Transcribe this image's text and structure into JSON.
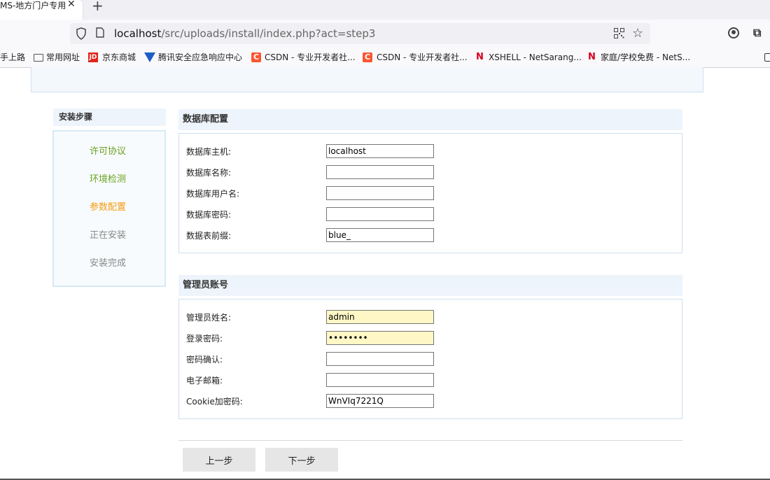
{
  "browser": {
    "tab_title": "MS-地方门户专用",
    "tab_close": "✕",
    "new_tab": "+",
    "url_host": "localhost",
    "url_path": "/src/uploads/install/index.php?act=step3",
    "bookmarks": [
      {
        "label": "手上路"
      },
      {
        "label": "常用网址"
      },
      {
        "label": "京东商城",
        "icon_text": "JD"
      },
      {
        "label": "腾讯安全应急响应中心"
      },
      {
        "label": "CSDN - 专业开发者社...",
        "icon_text": "C"
      },
      {
        "label": "CSDN - 专业开发者社...",
        "icon_text": "C"
      },
      {
        "label": "XSHELL - NetSarang...",
        "icon_text": "N"
      },
      {
        "label": "家庭/学校免费 - NetS...",
        "icon_text": "N"
      }
    ]
  },
  "sidebar": {
    "title": "安装步骤",
    "steps": [
      {
        "label": "许可协议",
        "color": "#6aa121"
      },
      {
        "label": "环境检测",
        "color": "#6aa121"
      },
      {
        "label": "参数配置",
        "color": "#f39c12"
      },
      {
        "label": "正在安装",
        "color": "#888888"
      },
      {
        "label": "安装完成",
        "color": "#888888"
      }
    ]
  },
  "db_section": {
    "title": "数据库配置",
    "fields": [
      {
        "label": "数据库主机:",
        "value": "localhost"
      },
      {
        "label": "数据库名称:",
        "value": ""
      },
      {
        "label": "数据库用户名:",
        "value": ""
      },
      {
        "label": "数据库密码:",
        "value": ""
      },
      {
        "label": "数据表前缀:",
        "value": "blue_"
      }
    ]
  },
  "admin_section": {
    "title": "管理员账号",
    "fields": [
      {
        "label": "管理员姓名:",
        "value": "admin"
      },
      {
        "label": "登录密码:",
        "value": "12345678"
      },
      {
        "label": "密码确认:",
        "value": ""
      },
      {
        "label": "电子邮箱:",
        "value": ""
      },
      {
        "label": "Cookie加密码:",
        "value": "WnVIq7221Q"
      }
    ]
  },
  "buttons": {
    "prev": "上一步",
    "next": "下一步"
  },
  "colors": {
    "accent_green": "#6aa121",
    "accent_orange": "#f39c12",
    "autofill": "#fff8c6"
  }
}
